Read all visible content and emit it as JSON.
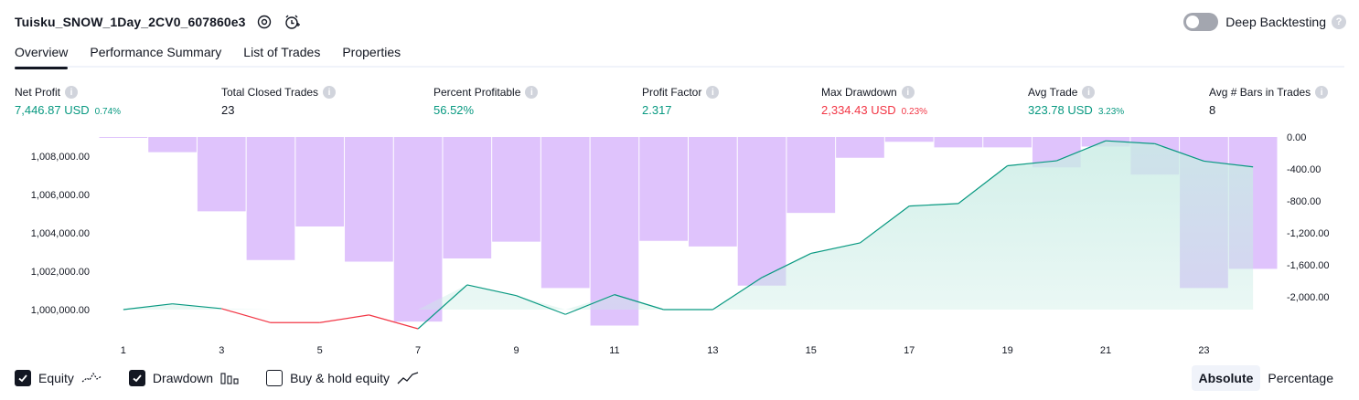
{
  "header": {
    "strategy_title": "Tuisku_SNOW_1Day_2CV0_607860e3",
    "deep_backtesting_label": "Deep Backtesting",
    "deep_backtesting_enabled": false
  },
  "tabs": [
    {
      "label": "Overview",
      "active": true
    },
    {
      "label": "Performance Summary",
      "active": false
    },
    {
      "label": "List of Trades",
      "active": false
    },
    {
      "label": "Properties",
      "active": false
    }
  ],
  "stats": {
    "net_profit": {
      "label": "Net Profit",
      "value": "7,446.87 USD",
      "sub": "0.74%"
    },
    "total_closed_trades": {
      "label": "Total Closed Trades",
      "value": "23"
    },
    "percent_profitable": {
      "label": "Percent Profitable",
      "value": "56.52%"
    },
    "profit_factor": {
      "label": "Profit Factor",
      "value": "2.317"
    },
    "max_drawdown": {
      "label": "Max Drawdown",
      "value": "2,334.43 USD",
      "sub": "0.23%"
    },
    "avg_trade": {
      "label": "Avg Trade",
      "value": "323.78 USD",
      "sub": "3.23%"
    },
    "avg_bars": {
      "label": "Avg # Bars in Trades",
      "value": "8"
    }
  },
  "legend": {
    "equity": {
      "label": "Equity",
      "checked": true
    },
    "drawdown": {
      "label": "Drawdown",
      "checked": true
    },
    "buy_hold": {
      "label": "Buy & hold equity",
      "checked": false
    }
  },
  "mode": {
    "absolute": "Absolute",
    "percentage": "Percentage",
    "active": "absolute"
  },
  "colors": {
    "equity_up": "#089981",
    "equity_down": "#f23645",
    "equity_fill": "#c8ece4",
    "drawdown_bar": "#d9b8fb"
  },
  "chart_data": {
    "type": "bar",
    "x": [
      1,
      2,
      3,
      4,
      5,
      6,
      7,
      8,
      9,
      10,
      11,
      12,
      13,
      14,
      15,
      16,
      17,
      18,
      19,
      20,
      21,
      22,
      23,
      24
    ],
    "x_tick_labels": [
      "1",
      "3",
      "5",
      "7",
      "9",
      "11",
      "13",
      "15",
      "17",
      "19",
      "21",
      "23"
    ],
    "series": [
      {
        "name": "Equity",
        "type": "area",
        "axis": "left",
        "values": [
          1000000,
          1000300,
          1000050,
          999320,
          999320,
          999720,
          999000,
          1001290,
          1000730,
          999750,
          1000780,
          1000000,
          1000000,
          1001670,
          1002930,
          1003480,
          1005400,
          1005530,
          1007500,
          1007760,
          1008800,
          1008650,
          1007740,
          1007440
        ]
      },
      {
        "name": "Drawdown",
        "type": "bar",
        "axis": "right",
        "values": [
          -10,
          -190,
          -930,
          -1540,
          -1120,
          -1560,
          -2310,
          -1520,
          -1310,
          -1890,
          -2360,
          -1300,
          -1370,
          -1860,
          -950,
          -260,
          -60,
          -130,
          -130,
          -380,
          -120,
          -470,
          -1890,
          -1650
        ]
      }
    ],
    "y_left": {
      "ticks": [
        "1,000,000.00",
        "1,002,000.00",
        "1,004,000.00",
        "1,006,000.00",
        "1,008,000.00"
      ],
      "ylim": [
        999000,
        1009000
      ]
    },
    "y_right": {
      "ticks": [
        "0.00",
        "-400.00",
        "-800.00",
        "-1,200.00",
        "-1,600.00",
        "-2,000.00"
      ],
      "ylim": [
        -2400,
        0
      ]
    }
  }
}
